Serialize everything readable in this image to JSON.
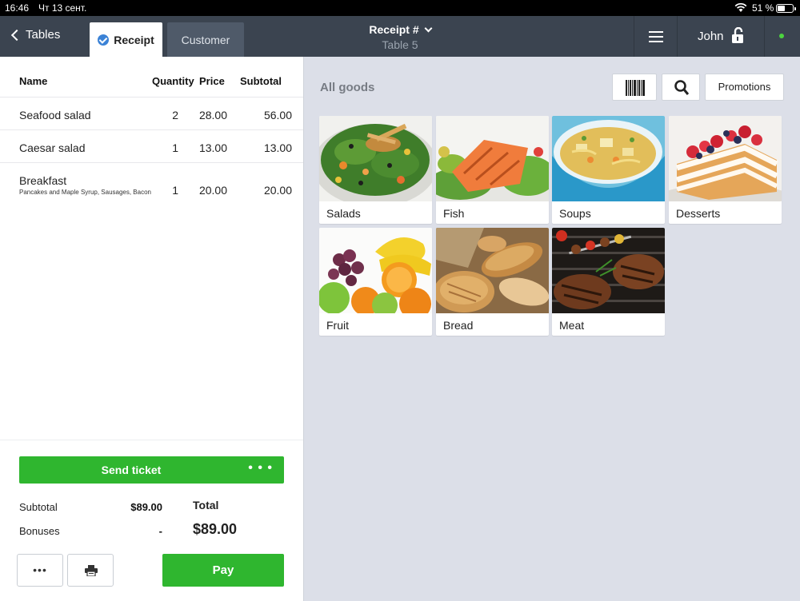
{
  "status_bar": {
    "time": "16:46",
    "date": "Чт 13 сент.",
    "battery": "51 %",
    "battery_level": 0.51
  },
  "nav": {
    "back_label": "Tables",
    "tabs": [
      {
        "label": "Receipt",
        "active": true
      },
      {
        "label": "Customer",
        "active": false
      }
    ],
    "receipt_title": "Receipt #",
    "table_label": "Table 5",
    "user": "John",
    "online_color": "#4cd43f"
  },
  "receipt": {
    "headers": {
      "name": "Name",
      "quantity": "Quantity",
      "price": "Price",
      "subtotal": "Subtotal"
    },
    "items": [
      {
        "name": "Seafood salad",
        "description": "",
        "quantity": "2",
        "price": "28.00",
        "subtotal": "56.00"
      },
      {
        "name": "Caesar salad",
        "description": "",
        "quantity": "1",
        "price": "13.00",
        "subtotal": "13.00"
      },
      {
        "name": "Breakfast",
        "description": "Pancakes and Maple Syrup, Sausages, Bacon",
        "quantity": "1",
        "price": "20.00",
        "subtotal": "20.00"
      }
    ],
    "send_ticket": "Send ticket",
    "send_more": "• • •",
    "subtotal_label": "Subtotal",
    "subtotal_value": "$89.00",
    "bonuses_label": "Bonuses",
    "bonuses_value": "-",
    "total_label": "Total",
    "total_value": "$89.00",
    "more_label": "•••",
    "pay_label": "Pay"
  },
  "goods": {
    "title": "All goods",
    "promotions_label": "Promotions",
    "categories": [
      {
        "name": "Salads",
        "icon": "salad-image"
      },
      {
        "name": "Fish",
        "icon": "fish-image"
      },
      {
        "name": "Soups",
        "icon": "soup-image"
      },
      {
        "name": "Desserts",
        "icon": "dessert-image"
      },
      {
        "name": "Fruit",
        "icon": "fruit-image"
      },
      {
        "name": "Bread",
        "icon": "bread-image"
      },
      {
        "name": "Meat",
        "icon": "meat-image"
      }
    ]
  },
  "colors": {
    "accent_green": "#2fb62f",
    "nav_bg": "#3b4450",
    "check_blue": "#3b82d6"
  }
}
